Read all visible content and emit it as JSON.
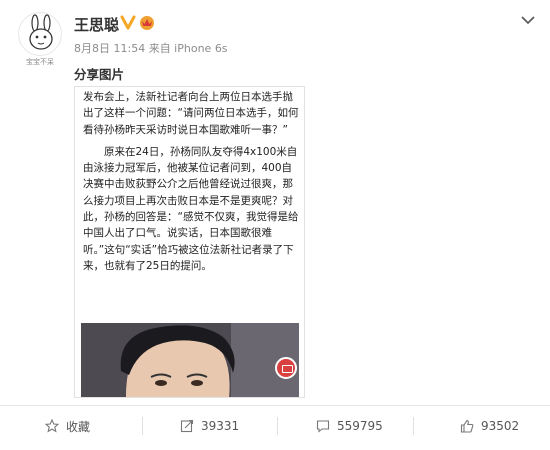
{
  "post": {
    "username": "王思聪",
    "meta": "8月8日 11:54 来自 iPhone 6s",
    "text": "分享图片",
    "avatar_caption": "宝宝不呆"
  },
  "article": {
    "para1": "发布会上，法新社记者向台上两位日本选手抛出了这样一个问题：“请问两位日本选手，如何看待孙杨昨天采访时说日本国歌难听一事？”",
    "para2": "原来在24日，孙杨同队友夺得4x100米自由泳接力冠军后，他被某位记者问到，400自决赛中击败荻野公介之后他曾经说过很爽，那么接力项目上再次击败日本是不是更爽呢？对此，孙杨的回答是：“感觉不仅爽，我觉得是给中国人出了口气。说实话，日本国歌很难听。”这句“实话”恰巧被这位法新社记者录了下来，也就有了25日的提问。"
  },
  "actions": {
    "favorite": "收藏",
    "repost": "39331",
    "comment": "559795",
    "like": "93502"
  },
  "colors": {
    "verified": "#f5a623",
    "bubble": "#d94040",
    "text": "#333333",
    "meta": "#8c8c8c"
  },
  "icons": [
    "avatar-icon",
    "verified-icon",
    "crown-icon",
    "more-options-icon",
    "star-icon",
    "repost-icon",
    "comment-icon",
    "like-icon"
  ]
}
